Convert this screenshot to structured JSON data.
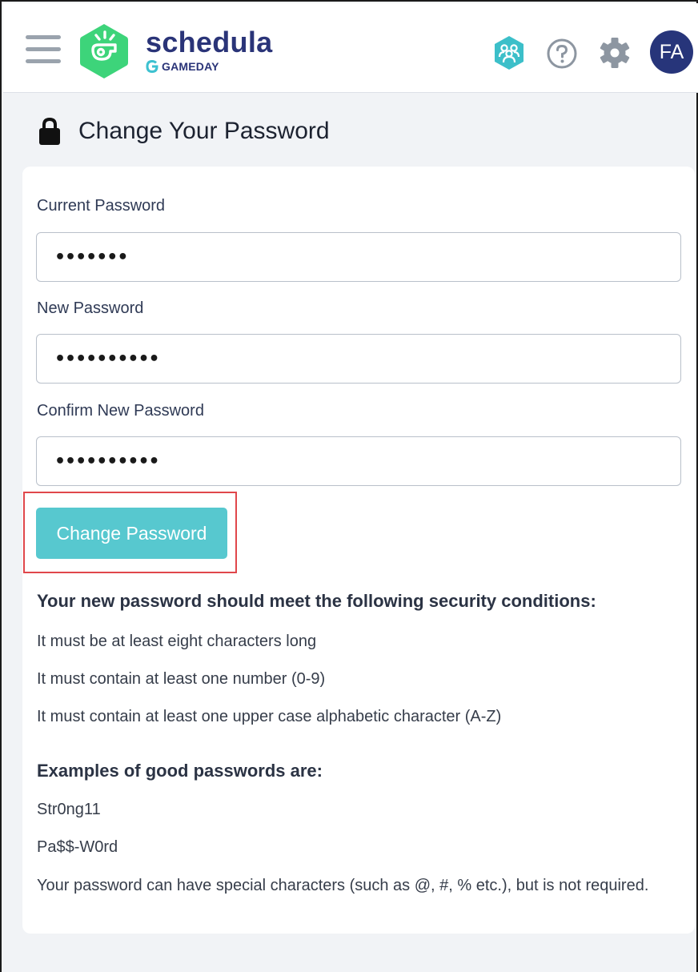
{
  "header": {
    "brand_name": "schedula",
    "brand_sub": "GAMEDAY",
    "avatar_initials": "FA",
    "colors": {
      "brand": "#2a3478",
      "logo_green": "#3dd47a",
      "accent": "#57c8cf",
      "avatar_bg": "#27357a"
    },
    "icons": [
      "menu-icon",
      "whistle-logo-icon",
      "team-icon",
      "help-icon",
      "gear-icon"
    ]
  },
  "page": {
    "title": "Change Your Password",
    "title_icon": "lock-icon"
  },
  "form": {
    "current_label": "Current Password",
    "current_value": "•••••••",
    "new_label": "New Password",
    "new_value": "••••••••••",
    "confirm_label": "Confirm New Password",
    "confirm_value": "••••••••••",
    "submit_label": "Change Password"
  },
  "requirements": {
    "heading": "Your new password should meet the following security conditions:",
    "items": [
      "It must be at least eight characters long",
      "It must contain at least one number (0-9)",
      "It must contain at least one upper case alphabetic character (A-Z)"
    ]
  },
  "examples": {
    "heading": "Examples of good passwords are:",
    "items": [
      "Str0ng11",
      "Pa$$-W0rd"
    ],
    "note": "Your password can have special characters (such as @, #, % etc.), but is not required."
  }
}
